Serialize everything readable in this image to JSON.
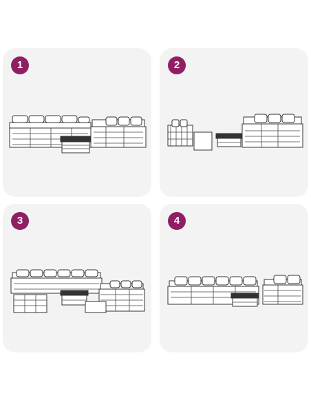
{
  "colors": {
    "badge_background": "#8f1f62",
    "badge_text": "#ffffff",
    "panel_background": "#f3f3f3",
    "page_background": "#ffffff"
  },
  "panels": [
    {
      "number": "1"
    },
    {
      "number": "2"
    },
    {
      "number": "3"
    },
    {
      "number": "4"
    }
  ]
}
